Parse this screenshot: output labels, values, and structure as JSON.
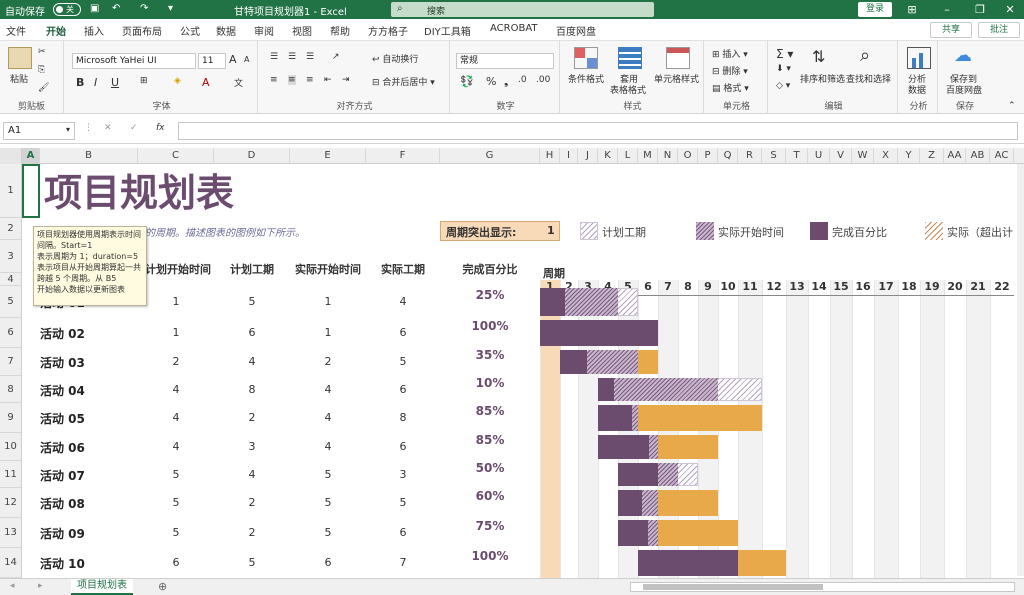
{
  "titlebar": {
    "autosave": "自动保存",
    "autosave_state": "关",
    "title": "甘特项目规划器1  -  Excel",
    "search": "搜索",
    "login": "登录"
  },
  "tabs": [
    "文件",
    "开始",
    "插入",
    "页面布局",
    "公式",
    "数据",
    "审阅",
    "视图",
    "帮助",
    "方方格子",
    "DIY工具箱",
    "ACROBAT",
    "百度网盘"
  ],
  "share": "共享",
  "annotate": "批注",
  "ribbon": {
    "clipboard": {
      "label": "剪贴板",
      "paste": "粘贴"
    },
    "font": {
      "label": "字体",
      "name": "Microsoft YaHei UI",
      "size": "11"
    },
    "align": {
      "label": "对齐方式",
      "wrap": "自动换行",
      "merge": "合并后居中"
    },
    "number": {
      "label": "数字",
      "format": "常规"
    },
    "styles": {
      "label": "样式",
      "cond": "条件格式",
      "table": "套用",
      "table2": "表格格式",
      "cell": "单元格样式"
    },
    "cells": {
      "label": "单元格",
      "insert": "插入",
      "delete": "删除",
      "format": "格式"
    },
    "edit": {
      "label": "编辑",
      "sort": "排序和筛选",
      "find": "查找和选择"
    },
    "analysis": {
      "label": "分析",
      "btn": "分析",
      "btn2": "数据"
    },
    "save": {
      "label": "保存",
      "btn": "保存到",
      "btn2": "百度网盘"
    }
  },
  "formula_bar": {
    "namebox": "A1",
    "formula": ""
  },
  "columns": [
    "A",
    "B",
    "C",
    "D",
    "E",
    "F",
    "G",
    "H",
    "I",
    "J",
    "K",
    "L",
    "M",
    "N",
    "O",
    "P",
    "Q",
    "R",
    "S",
    "T",
    "U",
    "V",
    "W",
    "X",
    "Y",
    "Z",
    "AA",
    "AB",
    "AC"
  ],
  "rows": [
    "1",
    "2",
    "3",
    "4",
    "5",
    "6",
    "7",
    "8",
    "9",
    "10",
    "11",
    "12",
    "13",
    "14"
  ],
  "sheet": {
    "title": "项目规划表",
    "subtitle": "的周期。描述图表的图例如下所示。",
    "period_label": "周期突出显示:",
    "period_value": "1",
    "headers": {
      "plan_start": "计划开始时间",
      "plan_dur": "计划工期",
      "act_start": "实际开始时间",
      "act_dur": "实际工期",
      "pct": "完成百分比",
      "period": "周期"
    },
    "legend": {
      "plan": "计划工期",
      "actual": "实际开始时间",
      "pct": "完成百分比",
      "over": "实际（超出计"
    },
    "activities": [
      {
        "name": "活动 01",
        "plan_start": "1",
        "plan_dur": "5",
        "act_start": "1",
        "act_dur": "4",
        "pct": "25%"
      },
      {
        "name": "活动 02",
        "plan_start": "1",
        "plan_dur": "6",
        "act_start": "1",
        "act_dur": "6",
        "pct": "100%"
      },
      {
        "name": "活动 03",
        "plan_start": "2",
        "plan_dur": "4",
        "act_start": "2",
        "act_dur": "5",
        "pct": "35%"
      },
      {
        "name": "活动 04",
        "plan_start": "4",
        "plan_dur": "8",
        "act_start": "4",
        "act_dur": "6",
        "pct": "10%"
      },
      {
        "name": "活动 05",
        "plan_start": "4",
        "plan_dur": "2",
        "act_start": "4",
        "act_dur": "8",
        "pct": "85%"
      },
      {
        "name": "活动 06",
        "plan_start": "4",
        "plan_dur": "3",
        "act_start": "4",
        "act_dur": "6",
        "pct": "85%"
      },
      {
        "name": "活动 07",
        "plan_start": "5",
        "plan_dur": "4",
        "act_start": "5",
        "act_dur": "3",
        "pct": "50%"
      },
      {
        "name": "活动 08",
        "plan_start": "5",
        "plan_dur": "2",
        "act_start": "5",
        "act_dur": "5",
        "pct": "60%"
      },
      {
        "name": "活动 09",
        "plan_start": "5",
        "plan_dur": "2",
        "act_start": "5",
        "act_dur": "6",
        "pct": "75%"
      },
      {
        "name": "活动 10",
        "plan_start": "6",
        "plan_dur": "5",
        "act_start": "6",
        "act_dur": "7",
        "pct": "100%"
      }
    ],
    "periods": [
      "1",
      "2",
      "3",
      "4",
      "5",
      "6",
      "7",
      "8",
      "9",
      "10",
      "11",
      "12",
      "13",
      "14",
      "15",
      "16",
      "17",
      "18",
      "19",
      "20",
      "21",
      "22"
    ]
  },
  "tooltip": "项目规划器使用周期表示时间间隔。Start=1\n表示周期为 1；duration=5\n表示项目从开始周期算起一共跨越 5 个周期。从 B5\n开始输入数据以更新图表",
  "sheet_tab": "项目规划表",
  "colors": {
    "excel_green": "#217346",
    "plan": "#b5a3c0",
    "pct": "#6b4c6e",
    "over": "#e8a94a",
    "highlight": "#f8d9b8"
  }
}
